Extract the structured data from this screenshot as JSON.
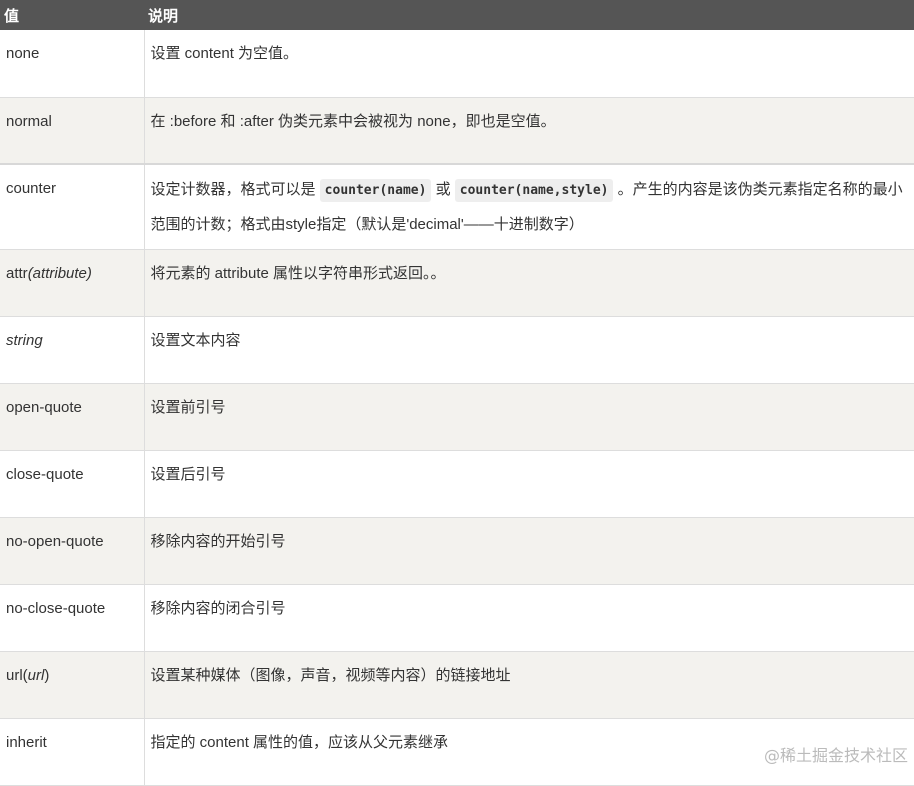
{
  "header": {
    "col1": "值",
    "col2": "说明"
  },
  "rows": [
    {
      "value": "none",
      "desc": "设置 content 为空值。"
    },
    {
      "value": "normal",
      "desc": "在 :before 和 :after 伪类元素中会被视为 none，即也是空值。"
    },
    {
      "value": "counter",
      "desc_a": "设定计数器，格式可以是 ",
      "code1": "counter(name)",
      "desc_b": " 或 ",
      "code2": "counter(name,style)",
      "desc_c": " 。产生的内容是该伪类元素指定名称的最小范围的计数；格式由style指定（默认是'decimal'——十进制数字）"
    },
    {
      "value_a": "attr",
      "value_em": "(attribute)",
      "desc": "将元素的 attribute 属性以字符串形式返回。。"
    },
    {
      "value_em": "string",
      "desc": "设置文本内容"
    },
    {
      "value": "open-quote",
      "desc": "设置前引号"
    },
    {
      "value": "close-quote",
      "desc": "设置后引号"
    },
    {
      "value": "no-open-quote",
      "desc": "移除内容的开始引号"
    },
    {
      "value": "no-close-quote",
      "desc": "移除内容的闭合引号"
    },
    {
      "value_a": "url(",
      "value_em": "url",
      "value_b": ")",
      "desc": "设置某种媒体（图像，声音，视频等内容）的链接地址"
    },
    {
      "value": "inherit",
      "desc": "指定的 content 属性的值，应该从父元素继承"
    }
  ],
  "watermark": "@稀土掘金技术社区"
}
